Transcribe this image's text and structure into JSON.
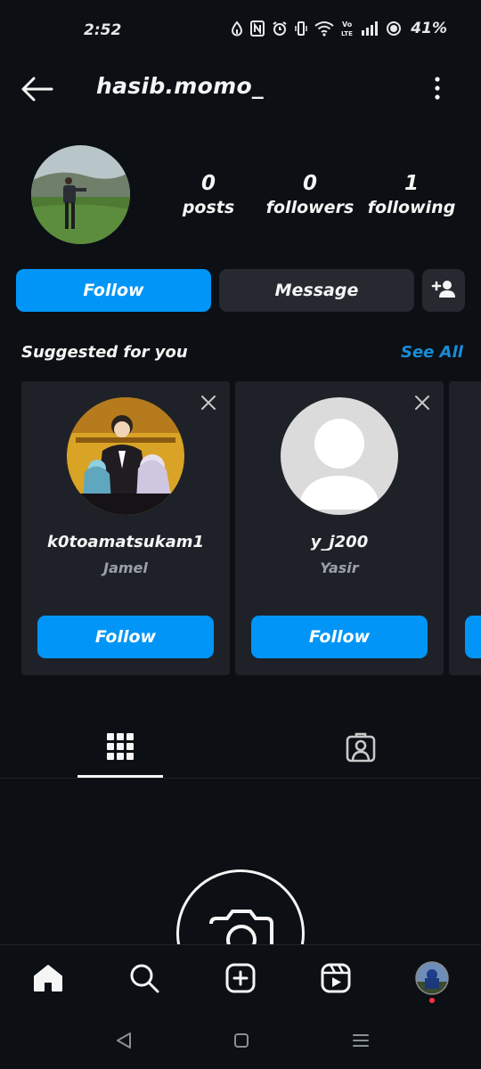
{
  "status_bar": {
    "time": "2:52",
    "battery": "41%",
    "icons": [
      "data-saver-icon",
      "nfc-icon",
      "alarm-icon",
      "vibrate-icon",
      "wifi-icon",
      "volte-icon",
      "signal-icon",
      "battery-icon"
    ]
  },
  "header": {
    "username": "hasib.momo_",
    "back_icon": "back-arrow-icon",
    "menu_icon": "more-vertical-icon"
  },
  "profile": {
    "stats": [
      {
        "value": "0",
        "label": "posts"
      },
      {
        "value": "0",
        "label": "followers"
      },
      {
        "value": "1",
        "label": "following"
      }
    ]
  },
  "actions": {
    "follow": "Follow",
    "message": "Message",
    "add_user_icon": "add-user-icon"
  },
  "suggested": {
    "title": "Suggested for you",
    "see_all": "See All",
    "cards": [
      {
        "username": "k0toamatsukam1",
        "name": "Jamel",
        "button": "Follow"
      },
      {
        "username": "y_j200",
        "name": "Yasir",
        "button": "Follow"
      }
    ]
  },
  "tabs": [
    {
      "icon": "grid-icon",
      "active": true
    },
    {
      "icon": "tagged-icon",
      "active": false
    }
  ],
  "bottom_nav": [
    "home-icon",
    "search-icon",
    "create-icon",
    "reels-icon",
    "profile-avatar"
  ],
  "colors": {
    "background": "#0c1014",
    "accent": "#0095f6",
    "link": "#1a8cd8",
    "card": "#1e2228",
    "secondary_button": "#262a30",
    "notification_dot": "#ff3040"
  }
}
